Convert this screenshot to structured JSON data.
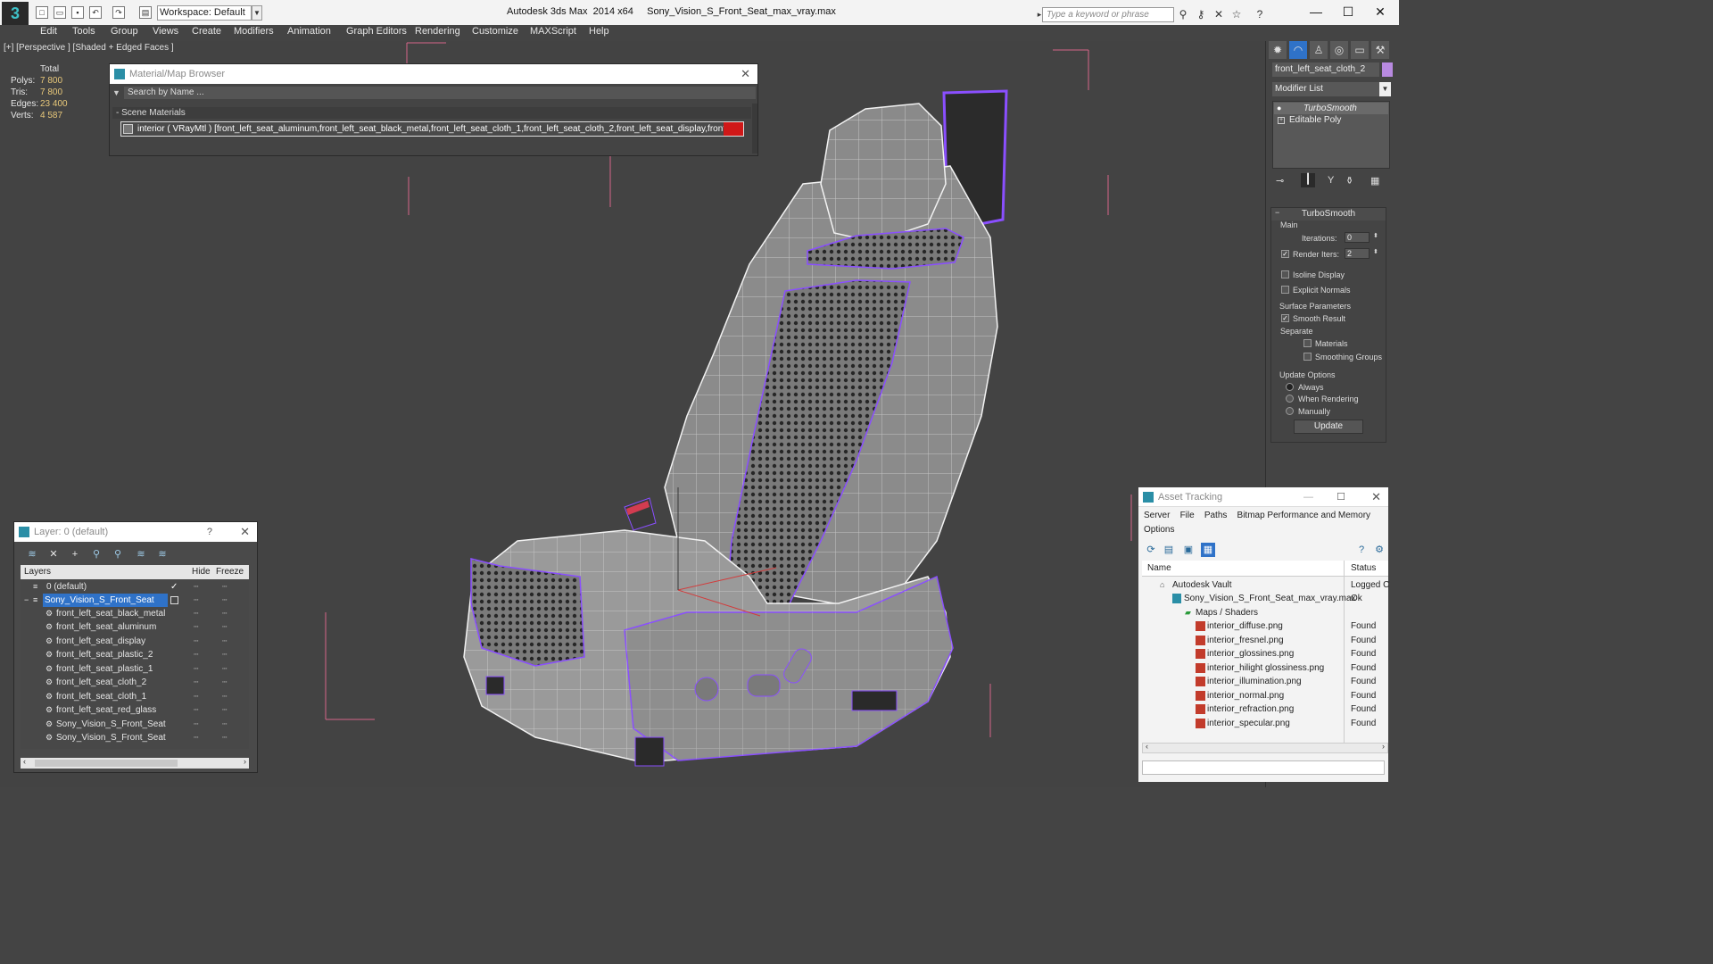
{
  "titlebar": {
    "workspace": "Workspace: Default",
    "title": "Autodesk 3ds Max  2014 x64     Sony_Vision_S_Front_Seat_max_vray.max",
    "search_placeholder": "Type a keyword or phrase"
  },
  "menu": [
    "Edit",
    "Tools",
    "Group",
    "Views",
    "Create",
    "Modifiers",
    "Animation",
    "Graph Editors",
    "Rendering",
    "Customize",
    "MAXScript",
    "Help"
  ],
  "viewport": {
    "label": "[+] [Perspective ] [Shaded + Edged Faces ]",
    "stats": {
      "header": "Total",
      "rows": [
        {
          "label": "Polys:",
          "value": "7 800"
        },
        {
          "label": "Tris:",
          "value": "7 800"
        },
        {
          "label": "Edges:",
          "value": "23 400"
        },
        {
          "label": "Verts:",
          "value": "4 587"
        }
      ]
    }
  },
  "material_browser": {
    "title": "Material/Map Browser",
    "search_placeholder": "Search by Name ...",
    "section": "- Scene Materials",
    "entry": "interior ( VRayMtl ) [front_left_seat_aluminum,front_left_seat_black_metal,front_left_seat_cloth_1,front_left_seat_cloth_2,front_left_seat_display,front_left_se..."
  },
  "command_panel": {
    "object_name": "front_left_seat_cloth_2",
    "modifier_list": "Modifier List",
    "stack": [
      "TurboSmooth",
      "Editable Poly"
    ],
    "turbosmooth": {
      "title": "TurboSmooth",
      "main": "Main",
      "iterations_label": "Iterations:",
      "iterations": "0",
      "render_iters_label": "Render Iters:",
      "render_iters": "2",
      "isoline": "Isoline Display",
      "explicit_normals": "Explicit Normals",
      "surface_params": "Surface Parameters",
      "smooth_result": "Smooth Result",
      "separate": "Separate",
      "materials": "Materials",
      "smoothing_groups": "Smoothing Groups",
      "update_options": "Update Options",
      "always": "Always",
      "when_rendering": "When Rendering",
      "manually": "Manually",
      "update": "Update"
    }
  },
  "layer_window": {
    "title": "Layer: 0 (default)",
    "help": "?",
    "columns": {
      "layers": "Layers",
      "hide": "Hide",
      "freeze": "Freeze"
    },
    "rows": [
      {
        "name": "0 (default)",
        "level": 0
      },
      {
        "name": "Sony_Vision_S_Front_Seat",
        "level": 0
      },
      {
        "name": "front_left_seat_black_metal",
        "level": 1
      },
      {
        "name": "front_left_seat_aluminum",
        "level": 1
      },
      {
        "name": "front_left_seat_display",
        "level": 1
      },
      {
        "name": "front_left_seat_plastic_2",
        "level": 1
      },
      {
        "name": "front_left_seat_plastic_1",
        "level": 1
      },
      {
        "name": "front_left_seat_cloth_2",
        "level": 1
      },
      {
        "name": "front_left_seat_cloth_1",
        "level": 1
      },
      {
        "name": "front_left_seat_red_glass",
        "level": 1
      },
      {
        "name": "Sony_Vision_S_Front_Seat",
        "level": 1
      },
      {
        "name": "Sony_Vision_S_Front_Seat",
        "level": 1
      }
    ]
  },
  "asset_tracking": {
    "title": "Asset Tracking",
    "menu": [
      "Server",
      "File",
      "Paths",
      "Bitmap Performance and Memory"
    ],
    "menu2": "Options",
    "columns": {
      "name": "Name",
      "status": "Status"
    },
    "rows": [
      {
        "name": "Autodesk Vault",
        "status": "Logged C"
      },
      {
        "name": "Sony_Vision_S_Front_Seat_max_vray.max",
        "status": "Ok"
      },
      {
        "name": "Maps / Shaders",
        "status": ""
      },
      {
        "name": "interior_diffuse.png",
        "status": "Found"
      },
      {
        "name": "interior_fresnel.png",
        "status": "Found"
      },
      {
        "name": "interior_glossines.png",
        "status": "Found"
      },
      {
        "name": "interior_hilight glossiness.png",
        "status": "Found"
      },
      {
        "name": "interior_illumination.png",
        "status": "Found"
      },
      {
        "name": "interior_normal.png",
        "status": "Found"
      },
      {
        "name": "interior_refraction.png",
        "status": "Found"
      },
      {
        "name": "interior_specular.png",
        "status": "Found"
      }
    ]
  },
  "colors": {
    "wire": "#8a4fff",
    "selection": "#2f72c8",
    "stat_value": "#e8c87a"
  }
}
